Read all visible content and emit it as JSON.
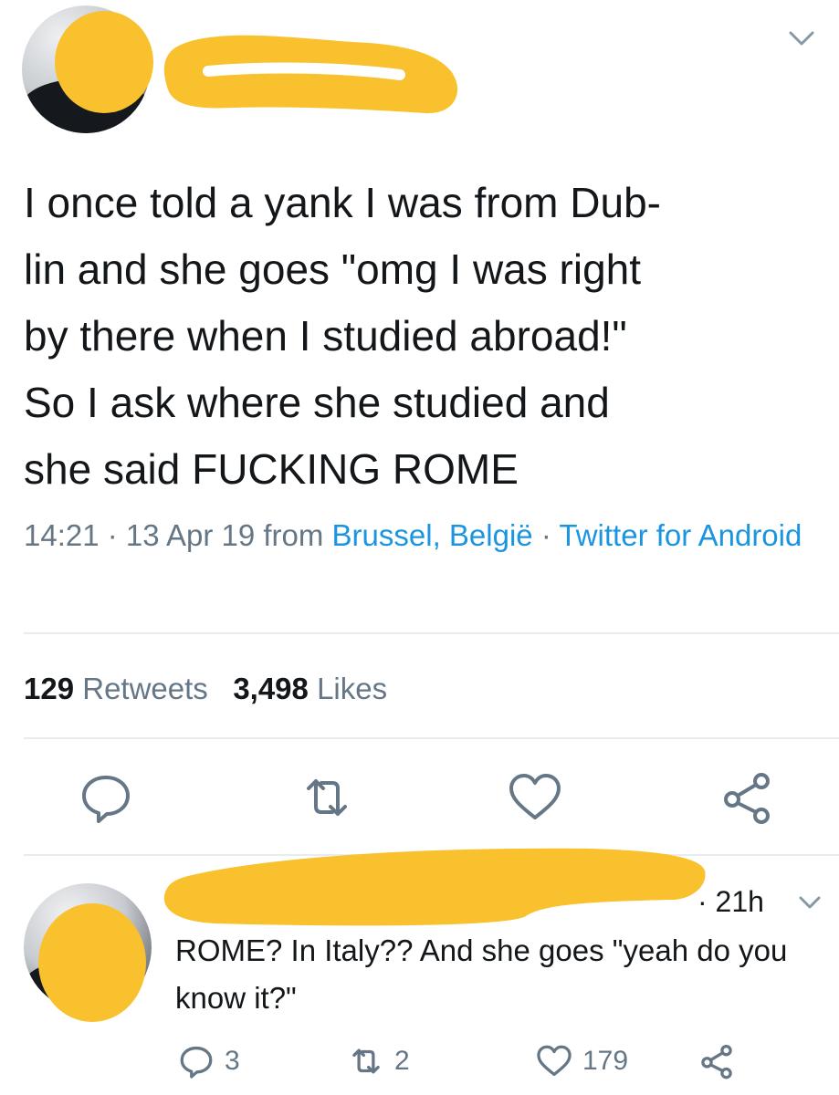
{
  "tweet": {
    "text": "I once told a yank I was from Dub-\nlin and she goes \"omg I was right\nby there when I studied abroad!\"\nSo I ask where she studied and\nshe said FUCKING ROME",
    "time": "14:21",
    "date": "13 Apr 19",
    "from_label": "from",
    "location": "Brussel, België",
    "client": "Twitter for Android",
    "sep": " · "
  },
  "stats": {
    "retweets_count": "129",
    "retweets_label": "Retweets",
    "likes_count": "3,498",
    "likes_label": "Likes"
  },
  "actions": {
    "icons": [
      "reply-icon",
      "retweet-icon",
      "like-icon",
      "share-icon"
    ]
  },
  "reply": {
    "time": "· 21h",
    "text": "ROME? In Italy?? And she goes \"yeah do you know it?\"",
    "reply_count": "3",
    "retweet_count": "2",
    "like_count": "179"
  },
  "colors": {
    "redaction": "#f8c12d",
    "link": "#1b95e0",
    "muted": "#657786",
    "text": "#14171a",
    "divider": "#e6ecf0"
  }
}
